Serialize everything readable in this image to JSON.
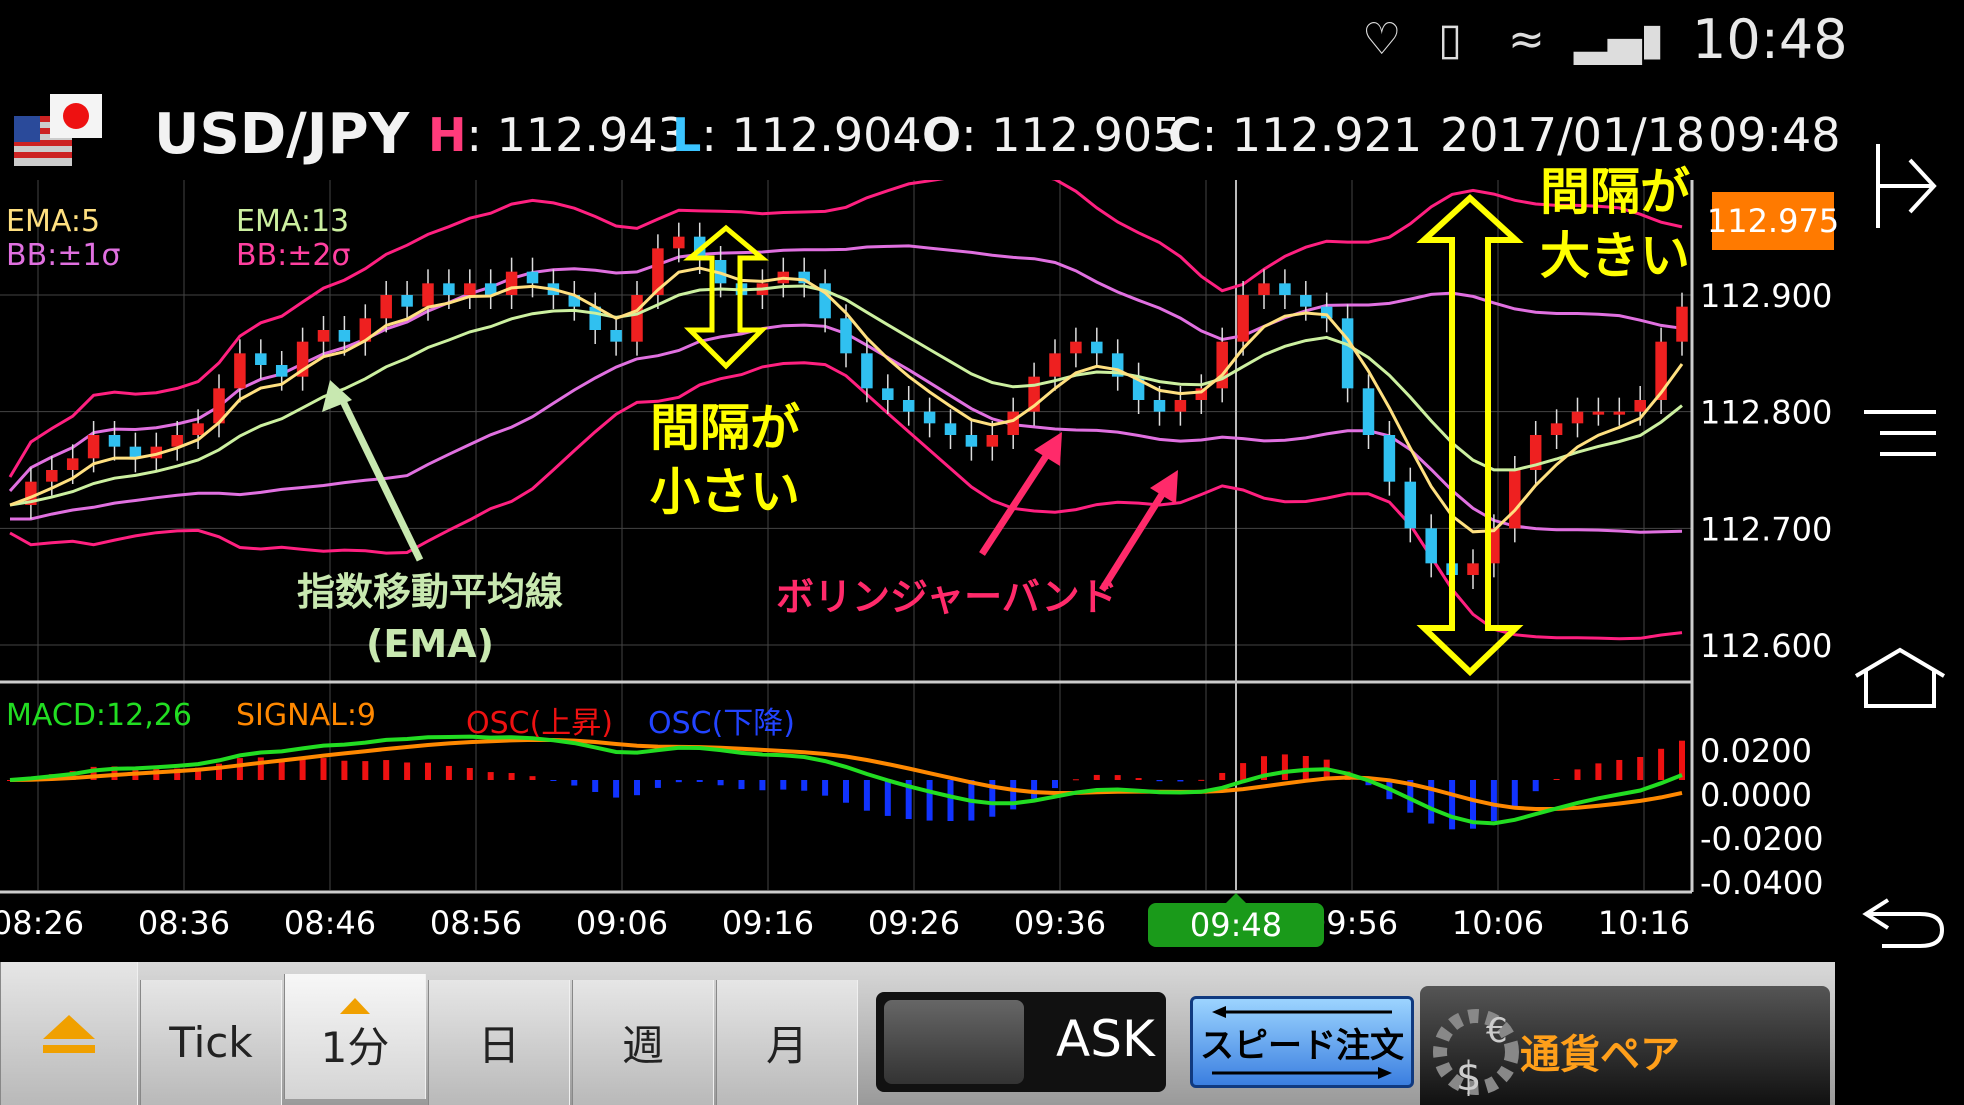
{
  "status_bar": {
    "time": "10:48"
  },
  "header": {
    "symbol": "USD/JPY",
    "high_label": "H",
    "high_value": "112.943",
    "low_label": "L",
    "low_value": "112.904",
    "open_label": "O",
    "open_value": "112.905",
    "close_label": "C",
    "close_value": "112.921",
    "date": "2017/01/18",
    "time": "09:48"
  },
  "legends": {
    "ema5": "EMA:5",
    "bb1": "BB:±1σ",
    "ema13": "EMA:13",
    "bb2": "BB:±2σ",
    "macd": "MACD:12,26",
    "signal": "SIGNAL:9",
    "osc_up": "OSC(上昇)",
    "osc_down": "OSC(下降)"
  },
  "annotations": {
    "narrow": [
      "間隔が",
      "小さい"
    ],
    "wide": [
      "間隔が",
      "大きい"
    ],
    "ema_label": [
      "指数移動平均線",
      "(EMA)"
    ],
    "bb_label": "ボリンジャーバンド"
  },
  "price_axis": {
    "current_price": "112.975",
    "ticks": [
      "112.900",
      "112.800",
      "112.700",
      "112.600"
    ]
  },
  "macd_axis": {
    "ticks": [
      "0.0200",
      "0.0000",
      "-0.0200",
      "-0.0400"
    ]
  },
  "time_axis": {
    "ticks": [
      "08:26",
      "08:36",
      "08:46",
      "08:56",
      "09:06",
      "09:16",
      "09:26",
      "09:36",
      "09:56",
      "10:06",
      "10:16"
    ],
    "cursor": "09:48"
  },
  "bottom_bar": {
    "tabs": [
      "Tick",
      "1分",
      "日",
      "週",
      "月"
    ],
    "active_tab": "1分",
    "ask_label": "ASK",
    "speed_order": "スピード注文",
    "currency_pair": "通貨ペア"
  },
  "colors": {
    "ema5": "#ffe080",
    "ema13": "#ccf0a0",
    "bb1": "#e070e0",
    "bb2": "#ff2080",
    "candle_up": "#ee2020",
    "candle_down": "#30c0f0",
    "macd": "#22dd22",
    "signal": "#ff8800",
    "osc_up": "#ee1111",
    "osc_down": "#1133ff",
    "annotation": "#ffff00",
    "price_tag": "#ff8000"
  },
  "chart_data": {
    "type": "candlestick",
    "symbol": "USD/JPY",
    "interval": "1分",
    "price_range": [
      112.57,
      112.99
    ],
    "close_series": [
      112.72,
      112.74,
      112.75,
      112.76,
      112.78,
      112.77,
      112.76,
      112.77,
      112.78,
      112.79,
      112.82,
      112.85,
      112.84,
      112.83,
      112.86,
      112.87,
      112.86,
      112.88,
      112.9,
      112.89,
      112.91,
      112.9,
      112.91,
      112.9,
      112.92,
      112.91,
      112.9,
      112.89,
      112.87,
      112.86,
      112.9,
      112.94,
      112.95,
      112.93,
      112.91,
      112.9,
      112.91,
      112.92,
      112.91,
      112.88,
      112.85,
      112.82,
      112.81,
      112.8,
      112.79,
      112.78,
      112.77,
      112.78,
      112.8,
      112.83,
      112.85,
      112.86,
      112.85,
      112.83,
      112.81,
      112.8,
      112.81,
      112.82,
      112.86,
      112.9,
      112.91,
      112.9,
      112.89,
      112.88,
      112.82,
      112.78,
      112.74,
      112.7,
      112.67,
      112.66,
      112.67,
      112.7,
      112.75,
      112.78,
      112.79,
      112.8,
      112.8,
      112.8,
      112.81,
      112.86,
      112.89
    ]
  }
}
